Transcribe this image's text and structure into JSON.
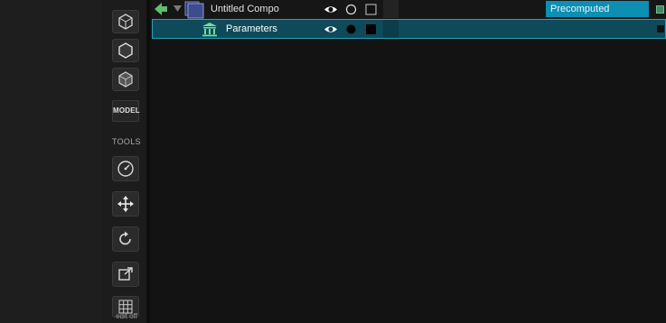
{
  "sidebar": {
    "model_label": "MODEL",
    "tools_label": "TOOLS",
    "edit_label": "edit off",
    "icons": [
      "cube-outline-icon",
      "cube-solid-icon",
      "cube-wire-icon",
      "compass-icon",
      "move-icon",
      "rotate-icon",
      "scale-icon",
      "grid-icon"
    ]
  },
  "layers": [
    {
      "name": "Untitled Compo",
      "type_label": "Precomputed",
      "visible": true
    },
    {
      "name": "Parameters",
      "visible": true
    }
  ],
  "colors": {
    "selected_row": "#0e4a5a",
    "badge": "#0c8fb3",
    "params_icon": "#6fdf98"
  }
}
